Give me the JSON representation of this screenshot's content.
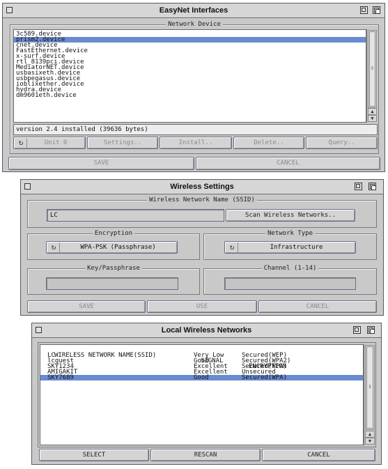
{
  "easynet": {
    "title": "EasyNet Interfaces",
    "group_title": "Network Device",
    "devices": [
      "3c589.device",
      "prism2.device",
      "cnet.device",
      "FastEthernet.device",
      "x-surf.device",
      "rtl_8139pci.device",
      "MediatorNET.device",
      "usbasixeth.device",
      "usbpegasus.device",
      "ioblixether.device",
      "hydra.device",
      "dm9601eth.device"
    ],
    "selected_index": 1,
    "status": "version 2.4 installed (39636 bytes)",
    "unit_label": "Unit 0",
    "settings_label": "Settings..",
    "install_label": "Install..",
    "delete_label": "Delete..",
    "query_label": "Query..",
    "save_label": "SAVE",
    "cancel_label": "CANCEL"
  },
  "wireless": {
    "title": "Wireless Settings",
    "ssid_group": "Wireless Network Name (SSID)",
    "ssid_value": "LC",
    "scan_label": "Scan Wireless Networks..",
    "encryption_group": "Encryption",
    "encryption_value": "WPA-PSK (Passphrase)",
    "nettype_group": "Network Type",
    "nettype_value": "Infrastructure",
    "key_group": "Key/Passphrase",
    "key_value": "",
    "channel_group": "Channel (1-14)",
    "channel_value": "",
    "save_label": "SAVE",
    "use_label": "USE",
    "cancel_label": "CANCEL"
  },
  "local": {
    "title": "Local Wireless Networks",
    "headers": {
      "ssid": "WIRELESS NETWORK NAME(SSID)",
      "signal": "SIGNAL",
      "encryption": "ENCRYPTION"
    },
    "networks": [
      {
        "ssid": "LC",
        "signal": "Very Low",
        "encryption": "Secured(WEP)"
      },
      {
        "ssid": "lcguest",
        "signal": "Good",
        "encryption": "Secured(WPA2)"
      },
      {
        "ssid": "SKY1234",
        "signal": "Excellent",
        "encryption": "Secured(WPA)"
      },
      {
        "ssid": "AMIGAKIT",
        "signal": "Excellent",
        "encryption": "Unsecured"
      },
      {
        "ssid": "SKY7689",
        "signal": "Good",
        "encryption": "Secured(WPA)"
      }
    ],
    "selected_index": 4,
    "select_label": "SELECT",
    "rescan_label": "RESCAN",
    "cancel_label": "CANCEL"
  },
  "icons": {
    "close": "close-gadget-icon",
    "zoom": "zoom-gadget-icon",
    "depth": "depth-gadget-icon",
    "cycle": "cycle-icon"
  },
  "colors": {
    "selection": "#6b8bd0",
    "window_bg": "#c9c9c9"
  }
}
